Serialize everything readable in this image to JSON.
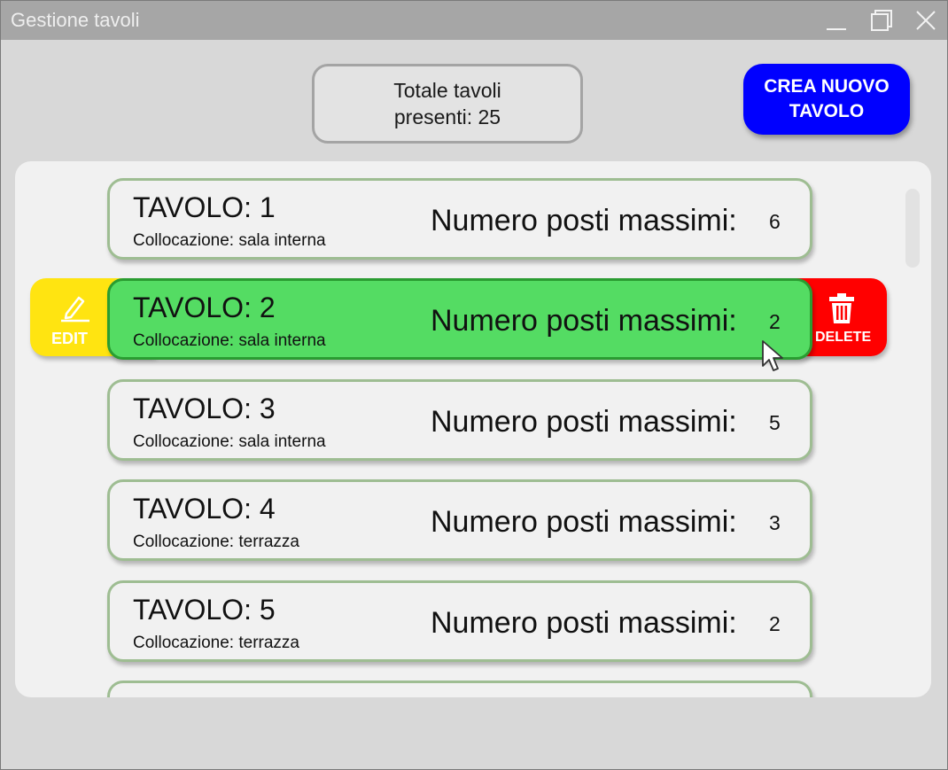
{
  "window": {
    "title": "Gestione tavoli"
  },
  "header": {
    "total_line1": "Totale tavoli",
    "total_line2": "presenti: 25",
    "create_line1": "CREA NUOVO",
    "create_line2": "TAVOLO"
  },
  "tables": [
    {
      "title": "TAVOLO: 1",
      "location": "Collocazione: sala interna",
      "seats_label": "Numero posti massimi:",
      "seats": "6"
    },
    {
      "title": "TAVOLO: 2",
      "location": "Collocazione: sala interna",
      "seats_label": "Numero posti massimi:",
      "seats": "2"
    },
    {
      "title": "TAVOLO: 3",
      "location": "Collocazione: sala interna",
      "seats_label": "Numero posti massimi:",
      "seats": "5"
    },
    {
      "title": "TAVOLO: 4",
      "location": "Collocazione: terrazza",
      "seats_label": "Numero posti massimi:",
      "seats": "3"
    },
    {
      "title": "TAVOLO: 5",
      "location": "Collocazione: terrazza",
      "seats_label": "Numero posti massimi:",
      "seats": "2"
    }
  ],
  "swipe_actions": {
    "edit_label": "EDIT",
    "delete_label": "DELETE",
    "edit_icon": "pencil-icon",
    "delete_icon": "trash-icon"
  },
  "colors": {
    "titlebar": "#a6a6a6",
    "create_button": "#0000ff",
    "selected_card": "#54dc63",
    "edit_action": "#ffe411",
    "delete_action": "#ff0000",
    "card_border": "#9ebd92"
  }
}
